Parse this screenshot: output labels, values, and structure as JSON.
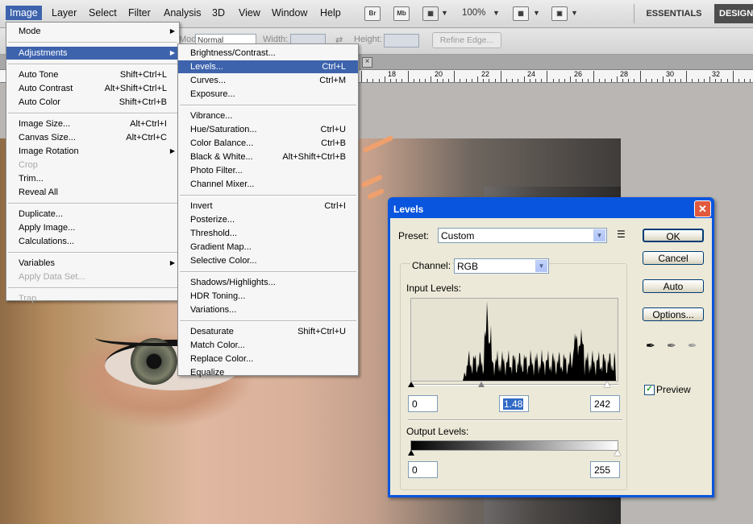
{
  "menubar": {
    "items": [
      "Image",
      "Layer",
      "Select",
      "Filter",
      "Analysis",
      "3D",
      "View",
      "Window",
      "Help"
    ],
    "bridge_icon": "Br",
    "minibridge_icon": "Mb",
    "zoom": "100%",
    "workspace_essentials": "ESSENTIALS",
    "workspace_design": "DESIGN"
  },
  "options": {
    "mode_label": "Mode:",
    "mode_value": "Normal",
    "width_label": "Width:",
    "height_label": "Height:",
    "refine_edge": "Refine Edge..."
  },
  "ruler": {
    "numbers": [
      "18",
      "20",
      "22",
      "24",
      "26",
      "28",
      "30",
      "32"
    ]
  },
  "image_menu": {
    "items": [
      {
        "label": "Mode",
        "shortcut": "",
        "submenu": true
      },
      {
        "separator": true
      },
      {
        "label": "Adjustments",
        "shortcut": "",
        "submenu": true,
        "highlight": true
      },
      {
        "separator": true
      },
      {
        "label": "Auto Tone",
        "shortcut": "Shift+Ctrl+L"
      },
      {
        "label": "Auto Contrast",
        "shortcut": "Alt+Shift+Ctrl+L"
      },
      {
        "label": "Auto Color",
        "shortcut": "Shift+Ctrl+B"
      },
      {
        "separator": true
      },
      {
        "label": "Image Size...",
        "shortcut": "Alt+Ctrl+I"
      },
      {
        "label": "Canvas Size...",
        "shortcut": "Alt+Ctrl+C"
      },
      {
        "label": "Image Rotation",
        "shortcut": "",
        "submenu": true
      },
      {
        "label": "Crop",
        "shortcut": "",
        "disabled": true
      },
      {
        "label": "Trim...",
        "shortcut": ""
      },
      {
        "label": "Reveal All",
        "shortcut": ""
      },
      {
        "separator": true
      },
      {
        "label": "Duplicate...",
        "shortcut": ""
      },
      {
        "label": "Apply Image...",
        "shortcut": ""
      },
      {
        "label": "Calculations...",
        "shortcut": ""
      },
      {
        "separator": true
      },
      {
        "label": "Variables",
        "shortcut": "",
        "submenu": true
      },
      {
        "label": "Apply Data Set...",
        "shortcut": "",
        "disabled": true
      },
      {
        "separator": true
      },
      {
        "label": "Trap...",
        "shortcut": "",
        "disabled": true
      }
    ]
  },
  "adjust_menu": {
    "items": [
      {
        "label": "Brightness/Contrast...",
        "shortcut": ""
      },
      {
        "label": "Levels...",
        "shortcut": "Ctrl+L",
        "highlight": true
      },
      {
        "label": "Curves...",
        "shortcut": "Ctrl+M"
      },
      {
        "label": "Exposure...",
        "shortcut": ""
      },
      {
        "separator": true
      },
      {
        "label": "Vibrance...",
        "shortcut": ""
      },
      {
        "label": "Hue/Saturation...",
        "shortcut": "Ctrl+U"
      },
      {
        "label": "Color Balance...",
        "shortcut": "Ctrl+B"
      },
      {
        "label": "Black & White...",
        "shortcut": "Alt+Shift+Ctrl+B"
      },
      {
        "label": "Photo Filter...",
        "shortcut": ""
      },
      {
        "label": "Channel Mixer...",
        "shortcut": ""
      },
      {
        "separator": true
      },
      {
        "label": "Invert",
        "shortcut": "Ctrl+I"
      },
      {
        "label": "Posterize...",
        "shortcut": ""
      },
      {
        "label": "Threshold...",
        "shortcut": ""
      },
      {
        "label": "Gradient Map...",
        "shortcut": ""
      },
      {
        "label": "Selective Color...",
        "shortcut": ""
      },
      {
        "separator": true
      },
      {
        "label": "Shadows/Highlights...",
        "shortcut": ""
      },
      {
        "label": "HDR Toning...",
        "shortcut": ""
      },
      {
        "label": "Variations...",
        "shortcut": ""
      },
      {
        "separator": true
      },
      {
        "label": "Desaturate",
        "shortcut": "Shift+Ctrl+U"
      },
      {
        "label": "Match Color...",
        "shortcut": ""
      },
      {
        "label": "Replace Color...",
        "shortcut": ""
      },
      {
        "label": "Equalize",
        "shortcut": ""
      }
    ]
  },
  "levels": {
    "title": "Levels",
    "preset_label": "Preset:",
    "preset_value": "Custom",
    "channel_label": "Channel:",
    "channel_value": "RGB",
    "input_label": "Input Levels:",
    "input_black": "0",
    "input_gamma": "1.48",
    "input_white": "242",
    "output_label": "Output Levels:",
    "output_black": "0",
    "output_white": "255",
    "ok": "OK",
    "cancel": "Cancel",
    "auto": "Auto",
    "options": "Options...",
    "preview_label": "Preview",
    "preview_checked": true,
    "input_gamma_slider": 0.34,
    "input_white_slider": 0.949
  }
}
